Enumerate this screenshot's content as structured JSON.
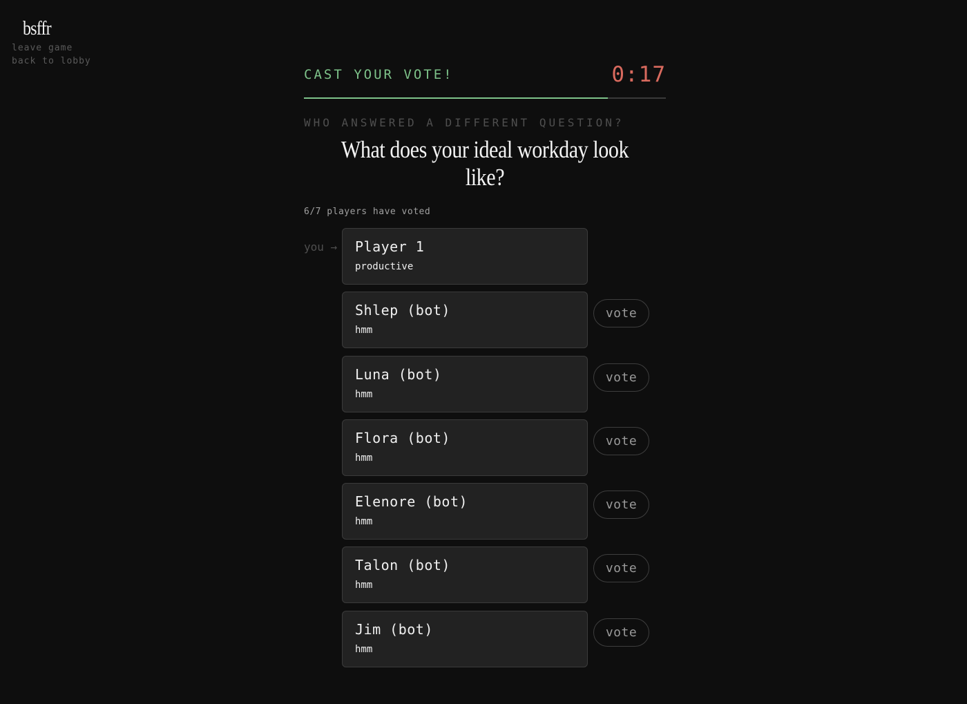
{
  "app": {
    "logo": "bsffr"
  },
  "nav": {
    "leave_game": "leave game",
    "back_to_lobby": "back to lobby"
  },
  "vote": {
    "title": "CAST YOUR VOTE!",
    "timer": "0:17",
    "time_progress": 0.84,
    "question_label": "WHO ANSWERED A DIFFERENT QUESTION?",
    "question": "What does your ideal workday look like?",
    "voted_count": "6/7 players have voted",
    "you_label": "you →",
    "vote_label": "vote"
  },
  "players": [
    {
      "name": "Player 1",
      "answer": "productive",
      "is_you": true
    },
    {
      "name": "Shlep (bot)",
      "answer": "hmm",
      "is_you": false
    },
    {
      "name": "Luna (bot)",
      "answer": "hmm",
      "is_you": false
    },
    {
      "name": "Flora (bot)",
      "answer": "hmm",
      "is_you": false
    },
    {
      "name": "Elenore (bot)",
      "answer": "hmm",
      "is_you": false
    },
    {
      "name": "Talon (bot)",
      "answer": "hmm",
      "is_you": false
    },
    {
      "name": "Jim (bot)",
      "answer": "hmm",
      "is_you": false
    }
  ],
  "colors": {
    "accent": "#7ec38a",
    "timer": "#d96a5e",
    "background": "#0e0e0e"
  }
}
